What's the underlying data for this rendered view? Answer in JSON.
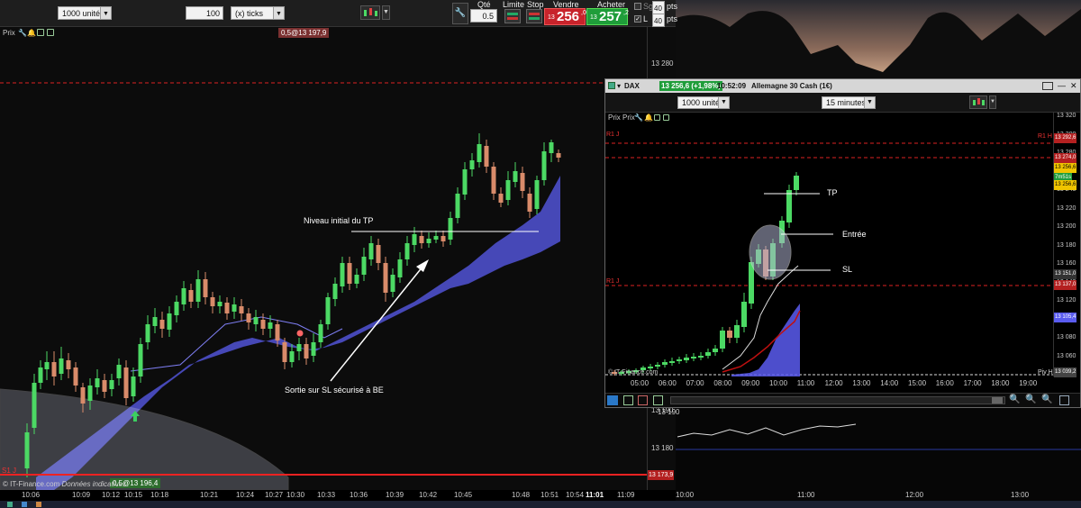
{
  "toolbar": {
    "quantity_label": "1000 unités",
    "ticks_value": "100",
    "ticks_label": "(x) ticks",
    "qty_header": "Qté",
    "qty_value": "0.5",
    "limit_label": "Limite",
    "stop_label": "Stop",
    "sell_label": "Vendre",
    "sell_price_prefix": "13",
    "sell_price_main": "256",
    "sell_price_suffix": ",0",
    "buy_label": "Acheter",
    "buy_price_prefix": "13",
    "buy_price_main": "257",
    "buy_price_suffix": ",2",
    "sg_label": "Sg",
    "sg_value": "40",
    "sg_unit": "pts",
    "l_label": "L",
    "l_value": "40",
    "l_unit": "pts"
  },
  "main_chart": {
    "panel_label": "Prix",
    "order_top_label": "0,5@13 197,9",
    "order_bottom_label": "0,5@13 196,4",
    "support_label": "S1 J",
    "price_axis": [
      "13 280",
      "13 190",
      "13 180"
    ],
    "price_tag": "13 173,9",
    "time_axis": [
      "10:06",
      "10:09",
      "10:12",
      "10:15",
      "10:18",
      "10:21",
      "10:24",
      "10:27",
      "10:30",
      "10:33",
      "10:36",
      "10:39",
      "10:42",
      "10:45",
      "10:48",
      "10:51",
      "10:54",
      "11:01",
      "11:09"
    ],
    "annotation_tp": "Niveau initial du TP",
    "annotation_sl": "Sortie sur SL sécurisé à BE",
    "copyright": "© IT-Finance.com",
    "copyright_note": "Données indicatives"
  },
  "sub_window": {
    "symbol": "DAX",
    "price_badge": "13 256,6 (+1,98%)",
    "time": "10:52:09",
    "instrument": "Allemagne 30 Cash (1€)",
    "panel_label": "Prix Prix",
    "quantity_label": "1000 unités",
    "interval_label": "15 minutes",
    "r1_label": "R1 H",
    "r1j_label": "R1 J",
    "piv_label": "Piv H",
    "copyright": "© IT-Finance.com",
    "price_axis": [
      "13 320",
      "13 300",
      "13 280",
      "13 260",
      "13 240",
      "13 220",
      "13 200",
      "13 180",
      "13 160",
      "13 140",
      "13 120",
      "13 100",
      "13 080",
      "13 060"
    ],
    "tag_r1h": "13 292,6",
    "tag_r1j": "13 274,0",
    "tag_last": "13 256,6",
    "tag_timer": "7m51s",
    "tag_last2": "13 256,6",
    "tag_sl": "13 151,0",
    "tag_s": "13 137,0",
    "tag_m": "13 105,4",
    "tag_piv": "13 039,2",
    "time_axis": [
      "05:00",
      "06:00",
      "07:00",
      "08:00",
      "09:00",
      "10:00",
      "11:00",
      "12:00",
      "13:00",
      "14:00",
      "15:00",
      "16:00",
      "17:00",
      "18:00",
      "19:00"
    ],
    "annotation_tp": "TP",
    "annotation_entry": "Entrée",
    "annotation_sl": "SL"
  },
  "background": {
    "time_axis": [
      "10:00",
      "11:00",
      "12:00",
      "13:00"
    ],
    "price_label": "13 190"
  },
  "colors": {
    "bull": "#4cd964",
    "bear": "#d98b6a",
    "cloud": "#5a5cf0",
    "sell": "#c8232b",
    "buy": "#1f9d3a"
  }
}
